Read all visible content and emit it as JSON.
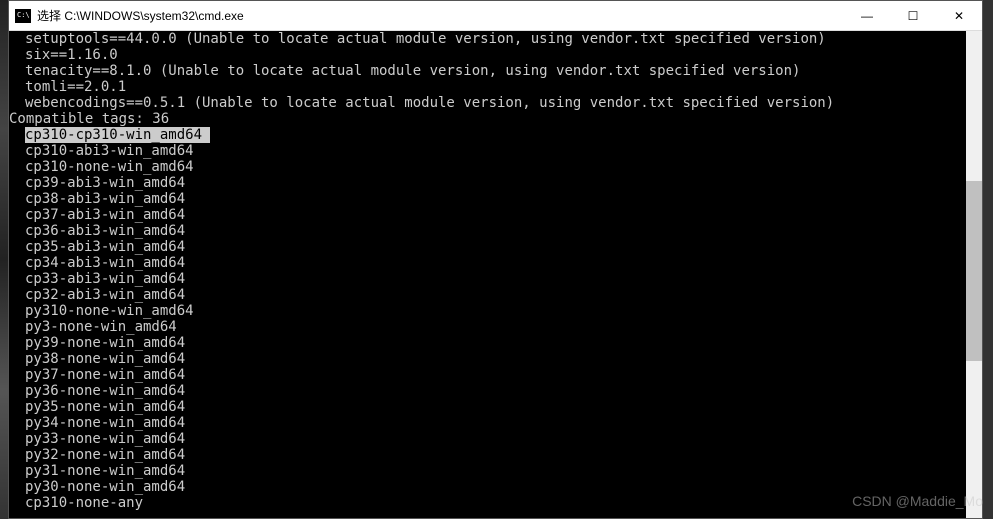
{
  "window": {
    "title": "选择 C:\\WINDOWS\\system32\\cmd.exe",
    "controls": {
      "minimize": "—",
      "maximize": "☐",
      "close": "✕"
    }
  },
  "terminal": {
    "lines": [
      {
        "text": "setuptools==44.0.0 (Unable to locate actual module version, using vendor.txt specified version)",
        "indent": true
      },
      {
        "text": "six==1.16.0",
        "indent": true
      },
      {
        "text": "tenacity==8.1.0 (Unable to locate actual module version, using vendor.txt specified version)",
        "indent": true
      },
      {
        "text": "tomli==2.0.1",
        "indent": true
      },
      {
        "text": "webencodings==0.5.1 (Unable to locate actual module version, using vendor.txt specified version)",
        "indent": true
      },
      {
        "text": "Compatible tags: 36",
        "indent": false
      },
      {
        "text": "cp310-cp310-win_amd64 ",
        "indent": true,
        "highlighted": true
      },
      {
        "text": "cp310-abi3-win_amd64",
        "indent": true
      },
      {
        "text": "cp310-none-win_amd64",
        "indent": true
      },
      {
        "text": "cp39-abi3-win_amd64",
        "indent": true
      },
      {
        "text": "cp38-abi3-win_amd64",
        "indent": true
      },
      {
        "text": "cp37-abi3-win_amd64",
        "indent": true
      },
      {
        "text": "cp36-abi3-win_amd64",
        "indent": true
      },
      {
        "text": "cp35-abi3-win_amd64",
        "indent": true
      },
      {
        "text": "cp34-abi3-win_amd64",
        "indent": true
      },
      {
        "text": "cp33-abi3-win_amd64",
        "indent": true
      },
      {
        "text": "cp32-abi3-win_amd64",
        "indent": true
      },
      {
        "text": "py310-none-win_amd64",
        "indent": true
      },
      {
        "text": "py3-none-win_amd64",
        "indent": true
      },
      {
        "text": "py39-none-win_amd64",
        "indent": true
      },
      {
        "text": "py38-none-win_amd64",
        "indent": true
      },
      {
        "text": "py37-none-win_amd64",
        "indent": true
      },
      {
        "text": "py36-none-win_amd64",
        "indent": true
      },
      {
        "text": "py35-none-win_amd64",
        "indent": true
      },
      {
        "text": "py34-none-win_amd64",
        "indent": true
      },
      {
        "text": "py33-none-win_amd64",
        "indent": true
      },
      {
        "text": "py32-none-win_amd64",
        "indent": true
      },
      {
        "text": "py31-none-win_amd64",
        "indent": true
      },
      {
        "text": "py30-none-win_amd64",
        "indent": true
      },
      {
        "text": "cp310-none-any",
        "indent": true
      }
    ]
  },
  "watermark": "CSDN @Maddie_Mo"
}
